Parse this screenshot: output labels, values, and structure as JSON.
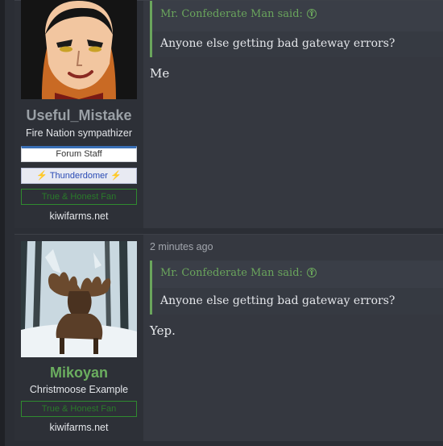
{
  "posts": [
    {
      "username": "Useful_Mistake",
      "user_title": "Fire Nation sympathizer",
      "banners": {
        "staff": "Forum Staff",
        "thunderdome": "Thunderdomer",
        "fan": "True & Honest Fan"
      },
      "site": "kiwifarms.net",
      "quote": {
        "author_line": "Mr. Confederate Man said:",
        "text": "Anyone else getting bad gateway errors?"
      },
      "message": "Me"
    },
    {
      "username": "Mikoyan",
      "user_title": "Christmoose Example",
      "banners": {
        "fan": "True & Honest Fan"
      },
      "site": "kiwifarms.net",
      "timestamp": "2 minutes ago",
      "quote": {
        "author_line": "Mr. Confederate Man said:",
        "text": "Anyone else getting bad gateway errors?"
      },
      "message": "Yep."
    }
  ],
  "icons": {
    "bolt": "⚡",
    "quote_jump": "arrow-up-circle-icon"
  },
  "colors": {
    "background": "#2b2e35",
    "post_bg": "#353840",
    "quote_accent": "#6aa55c",
    "username_green": "#6bae5f",
    "username_grey": "#9aa0a6"
  }
}
